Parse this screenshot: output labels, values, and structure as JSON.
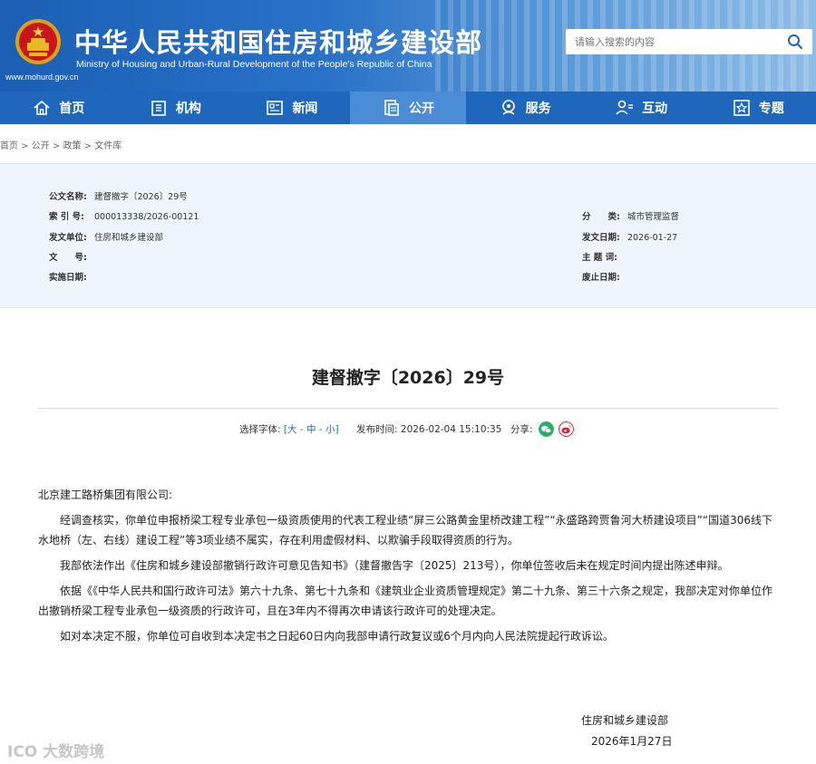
{
  "header": {
    "title_cn": "中华人民共和国住房和城乡建设部",
    "title_en": "Ministry of Housing and Urban-Rural Development of the People's Republic of China",
    "url": "www.mohurd.gov.cn",
    "search_placeholder": "请输入搜索的内容"
  },
  "nav": [
    {
      "label": "首页",
      "icon": "home-icon"
    },
    {
      "label": "机构",
      "icon": "building-icon"
    },
    {
      "label": "新闻",
      "icon": "news-icon"
    },
    {
      "label": "公开",
      "icon": "document-icon",
      "active": true
    },
    {
      "label": "服务",
      "icon": "service-icon"
    },
    {
      "label": "互动",
      "icon": "interaction-icon"
    },
    {
      "label": "专题",
      "icon": "star-icon"
    }
  ],
  "breadcrumb": "首页 > 公开 > 政策 > 文件库",
  "info": {
    "doc_name_k": "公文名称:",
    "doc_name_v": "建督撤字〔2026〕29号",
    "index_k": "索 引 号:",
    "index_v": "000013338/2026-00121",
    "category_k": "分　　类:",
    "category_v": "城市管理监督",
    "issuer_k": "发文单位:",
    "issuer_v": "住房和城乡建设部",
    "date_k": "发文日期:",
    "date_v": "2026-01-27",
    "docno_k": "文　　号:",
    "docno_v": "",
    "subject_k": "主 题 词:",
    "subject_v": "",
    "effective_k": "实施日期:",
    "effective_v": "",
    "abolish_k": "废止日期:",
    "abolish_v": ""
  },
  "article": {
    "title": "建督撤字〔2026〕29号",
    "font_label": "选择字体:",
    "font_open": "[",
    "font_large": "大",
    "font_sep1": " - ",
    "font_mid": "中",
    "font_sep2": " - ",
    "font_small": "小",
    "font_close": "]",
    "publish_label": "发布时间:",
    "publish_time": "2026-02-04 15:10:35",
    "share_label": "分享:",
    "salutation": "北京建工路桥集团有限公司:",
    "p1": "经调查核实，你单位申报桥梁工程专业承包一级资质使用的代表工程业绩“屏三公路黄金里桥改建工程”“永盛路跨贾鲁河大桥建设项目”“国道306线下水地桥（左、右线）建设工程”等3项业绩不属实，存在利用虚假材料、以欺骗手段取得资质的行为。",
    "p2": "我部依法作出《住房和城乡建设部撤销行政许可意见告知书》（建督撤告字〔2025〕213号），你单位签收后未在规定时间内提出陈述申辩。",
    "p3": "依据《《中华人民共和国行政许可法》第六十九条、第七十九条和《建筑业企业资质管理规定》第二十九条、第三十六条之规定，我部决定对你单位作出撤销桥梁工程专业承包一级资质的行政许可，且在3年内不得再次申请该行政许可的处理决定。",
    "p4": "如对本决定不服，你单位可自收到本决定书之日起60日内向我部申请行政复议或6个月内向人民法院提起行政诉讼。",
    "signer": "住房和城乡建设部",
    "sign_date": "2026年1月27日"
  },
  "watermark": "大数跨境",
  "colors": {
    "nav_bg": "#1f67bd",
    "nav_active": "#4a8dd6",
    "info_bg": "#eef5fc",
    "wechat": "#2aae67",
    "weibo": "#e6162d"
  }
}
